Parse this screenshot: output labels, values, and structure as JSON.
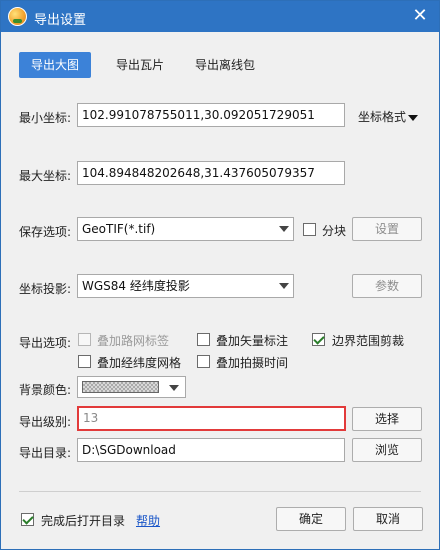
{
  "window": {
    "title": "导出设置",
    "close_glyph": "✕"
  },
  "tabs": [
    {
      "label": "导出大图",
      "active": true
    },
    {
      "label": "导出瓦片",
      "active": false
    },
    {
      "label": "导出离线包",
      "active": false
    }
  ],
  "min_coord": {
    "label": "最小坐标:",
    "value": "102.991078755011,30.092051729051"
  },
  "coord_format": {
    "label": "坐标格式"
  },
  "max_coord": {
    "label": "最大坐标:",
    "value": "104.894848202648,31.437605079357"
  },
  "save_option": {
    "label": "保存选项:",
    "value": "GeoTIF(*.tif)",
    "tile_label": "分块",
    "settings_label": "设置"
  },
  "projection": {
    "label": "坐标投影:",
    "value": "WGS84 经纬度投影",
    "params_label": "参数"
  },
  "export_options": {
    "label": "导出选项:",
    "items": [
      {
        "label": "叠加路网标签",
        "checked": false,
        "disabled": true
      },
      {
        "label": "叠加矢量标注",
        "checked": false,
        "disabled": false
      },
      {
        "label": "边界范围剪裁",
        "checked": true,
        "disabled": false
      },
      {
        "label": "叠加经纬度网格",
        "checked": false,
        "disabled": false
      },
      {
        "label": "叠加拍摄时间",
        "checked": false,
        "disabled": false
      }
    ]
  },
  "background": {
    "label": "背景颜色:"
  },
  "level": {
    "label": "导出级别:",
    "value": "13",
    "select_label": "选择"
  },
  "directory": {
    "label": "导出目录:",
    "value": "D:\\SGDownload",
    "browse_label": "浏览"
  },
  "footer": {
    "open_after_label": "完成后打开目录",
    "open_after_checked": true,
    "help_label": "帮助",
    "ok_label": "确定",
    "cancel_label": "取消"
  },
  "colors": {
    "titlebar": "#2e74c4",
    "active_tab": "#3c82d8",
    "highlight_border": "#e23a3a",
    "link": "#1a56c8"
  }
}
